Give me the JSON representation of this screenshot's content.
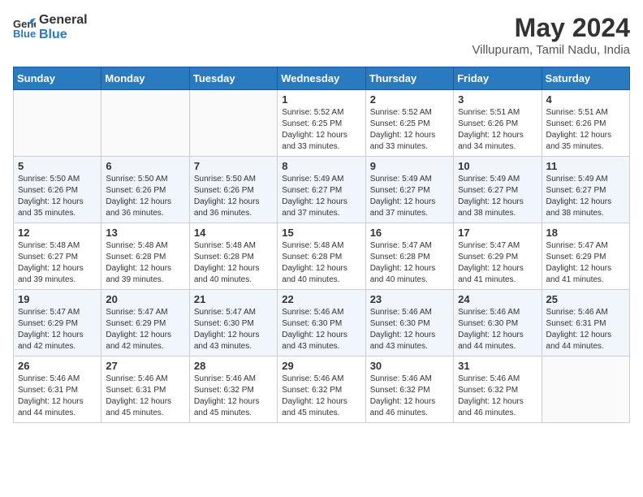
{
  "header": {
    "logo_general": "General",
    "logo_blue": "Blue",
    "month_year": "May 2024",
    "location": "Villupuram, Tamil Nadu, India"
  },
  "days_of_week": [
    "Sunday",
    "Monday",
    "Tuesday",
    "Wednesday",
    "Thursday",
    "Friday",
    "Saturday"
  ],
  "weeks": [
    [
      {
        "day": "",
        "info": ""
      },
      {
        "day": "",
        "info": ""
      },
      {
        "day": "",
        "info": ""
      },
      {
        "day": "1",
        "info": "Sunrise: 5:52 AM\nSunset: 6:25 PM\nDaylight: 12 hours and 33 minutes."
      },
      {
        "day": "2",
        "info": "Sunrise: 5:52 AM\nSunset: 6:25 PM\nDaylight: 12 hours and 33 minutes."
      },
      {
        "day": "3",
        "info": "Sunrise: 5:51 AM\nSunset: 6:26 PM\nDaylight: 12 hours and 34 minutes."
      },
      {
        "day": "4",
        "info": "Sunrise: 5:51 AM\nSunset: 6:26 PM\nDaylight: 12 hours and 35 minutes."
      }
    ],
    [
      {
        "day": "5",
        "info": "Sunrise: 5:50 AM\nSunset: 6:26 PM\nDaylight: 12 hours and 35 minutes."
      },
      {
        "day": "6",
        "info": "Sunrise: 5:50 AM\nSunset: 6:26 PM\nDaylight: 12 hours and 36 minutes."
      },
      {
        "day": "7",
        "info": "Sunrise: 5:50 AM\nSunset: 6:26 PM\nDaylight: 12 hours and 36 minutes."
      },
      {
        "day": "8",
        "info": "Sunrise: 5:49 AM\nSunset: 6:27 PM\nDaylight: 12 hours and 37 minutes."
      },
      {
        "day": "9",
        "info": "Sunrise: 5:49 AM\nSunset: 6:27 PM\nDaylight: 12 hours and 37 minutes."
      },
      {
        "day": "10",
        "info": "Sunrise: 5:49 AM\nSunset: 6:27 PM\nDaylight: 12 hours and 38 minutes."
      },
      {
        "day": "11",
        "info": "Sunrise: 5:49 AM\nSunset: 6:27 PM\nDaylight: 12 hours and 38 minutes."
      }
    ],
    [
      {
        "day": "12",
        "info": "Sunrise: 5:48 AM\nSunset: 6:27 PM\nDaylight: 12 hours and 39 minutes."
      },
      {
        "day": "13",
        "info": "Sunrise: 5:48 AM\nSunset: 6:28 PM\nDaylight: 12 hours and 39 minutes."
      },
      {
        "day": "14",
        "info": "Sunrise: 5:48 AM\nSunset: 6:28 PM\nDaylight: 12 hours and 40 minutes."
      },
      {
        "day": "15",
        "info": "Sunrise: 5:48 AM\nSunset: 6:28 PM\nDaylight: 12 hours and 40 minutes."
      },
      {
        "day": "16",
        "info": "Sunrise: 5:47 AM\nSunset: 6:28 PM\nDaylight: 12 hours and 40 minutes."
      },
      {
        "day": "17",
        "info": "Sunrise: 5:47 AM\nSunset: 6:29 PM\nDaylight: 12 hours and 41 minutes."
      },
      {
        "day": "18",
        "info": "Sunrise: 5:47 AM\nSunset: 6:29 PM\nDaylight: 12 hours and 41 minutes."
      }
    ],
    [
      {
        "day": "19",
        "info": "Sunrise: 5:47 AM\nSunset: 6:29 PM\nDaylight: 12 hours and 42 minutes."
      },
      {
        "day": "20",
        "info": "Sunrise: 5:47 AM\nSunset: 6:29 PM\nDaylight: 12 hours and 42 minutes."
      },
      {
        "day": "21",
        "info": "Sunrise: 5:47 AM\nSunset: 6:30 PM\nDaylight: 12 hours and 43 minutes."
      },
      {
        "day": "22",
        "info": "Sunrise: 5:46 AM\nSunset: 6:30 PM\nDaylight: 12 hours and 43 minutes."
      },
      {
        "day": "23",
        "info": "Sunrise: 5:46 AM\nSunset: 6:30 PM\nDaylight: 12 hours and 43 minutes."
      },
      {
        "day": "24",
        "info": "Sunrise: 5:46 AM\nSunset: 6:30 PM\nDaylight: 12 hours and 44 minutes."
      },
      {
        "day": "25",
        "info": "Sunrise: 5:46 AM\nSunset: 6:31 PM\nDaylight: 12 hours and 44 minutes."
      }
    ],
    [
      {
        "day": "26",
        "info": "Sunrise: 5:46 AM\nSunset: 6:31 PM\nDaylight: 12 hours and 44 minutes."
      },
      {
        "day": "27",
        "info": "Sunrise: 5:46 AM\nSunset: 6:31 PM\nDaylight: 12 hours and 45 minutes."
      },
      {
        "day": "28",
        "info": "Sunrise: 5:46 AM\nSunset: 6:32 PM\nDaylight: 12 hours and 45 minutes."
      },
      {
        "day": "29",
        "info": "Sunrise: 5:46 AM\nSunset: 6:32 PM\nDaylight: 12 hours and 45 minutes."
      },
      {
        "day": "30",
        "info": "Sunrise: 5:46 AM\nSunset: 6:32 PM\nDaylight: 12 hours and 46 minutes."
      },
      {
        "day": "31",
        "info": "Sunrise: 5:46 AM\nSunset: 6:32 PM\nDaylight: 12 hours and 46 minutes."
      },
      {
        "day": "",
        "info": ""
      }
    ]
  ]
}
